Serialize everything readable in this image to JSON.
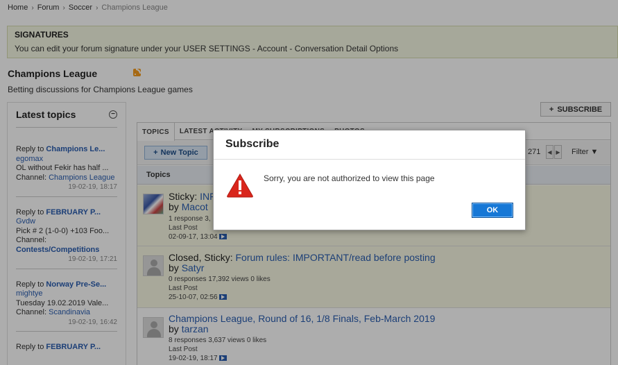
{
  "breadcrumb": {
    "items": [
      "Home",
      "Forum",
      "Soccer"
    ],
    "current": "Champions League"
  },
  "notice": {
    "title": "SIGNATURES",
    "text": "You can edit your forum signature under your USER SETTINGS - Account - Conversation Detail Options"
  },
  "forum": {
    "title": "Champions League",
    "description": "Betting discussions for Champions League games"
  },
  "sidebar": {
    "title": "Latest topics",
    "items": [
      {
        "prefix": "Reply to",
        "topic": "Champions Le...",
        "user": "egomax",
        "snippet": "OL without Fekir has half ...",
        "channel_label": "Channel:",
        "channel": "Champions League",
        "date": "19-02-19, 18:17"
      },
      {
        "prefix": "Reply to",
        "topic": "FEBRUARY P...",
        "user": "Gvdw",
        "snippet": "Pick # 2 (1-0-0) +103 Foo...",
        "channel_label": "Channel:",
        "channel": "Contests/Competitions",
        "date": "19-02-19, 17:21"
      },
      {
        "prefix": "Reply to",
        "topic": "Norway Pre-Se...",
        "user": "mightye",
        "snippet": "Tuesday 19.02.2019 Vale...",
        "channel_label": "Channel:",
        "channel": "Scandinavia",
        "date": "19-02-19, 16:42"
      },
      {
        "prefix": "Reply to",
        "topic": "FEBRUARY P..."
      }
    ]
  },
  "subscribe_button": "SUBSCRIBE",
  "tabs": [
    "TOPICS",
    "LATEST ACTIVITY",
    "MY SUBSCRIPTIONS",
    "PHOTOS"
  ],
  "toolbar": {
    "new_topic": "New Topic",
    "page_total": "271",
    "filter": "Filter"
  },
  "columns": {
    "topics": "Topics"
  },
  "topics": [
    {
      "prefix": "Sticky:",
      "title": "INF",
      "by": "by",
      "author": "Macot",
      "stats": "1 response 3,",
      "last_post_label": "Last Post",
      "last_post": "02-09-17, 13:04"
    },
    {
      "prefix": "Closed, Sticky:",
      "title": "Forum rules: IMPORTANT/read before posting",
      "by": "by",
      "author": "Satyr",
      "stats": "0 responses 17,392 views 0 likes",
      "last_post_label": "Last Post",
      "last_post": "25-10-07, 02:56"
    },
    {
      "prefix": "",
      "title": "Champions League, Round of 16, 1/8 Finals, Feb-March 2019",
      "by": "by",
      "author": "tarzan",
      "stats": "8 responses 3,637 views 0 likes",
      "last_post_label": "Last Post",
      "last_post": "19-02-19, 18:17"
    }
  ],
  "dialog": {
    "title": "Subscribe",
    "message": "Sorry, you are not authorized to view this page",
    "ok": "OK"
  }
}
